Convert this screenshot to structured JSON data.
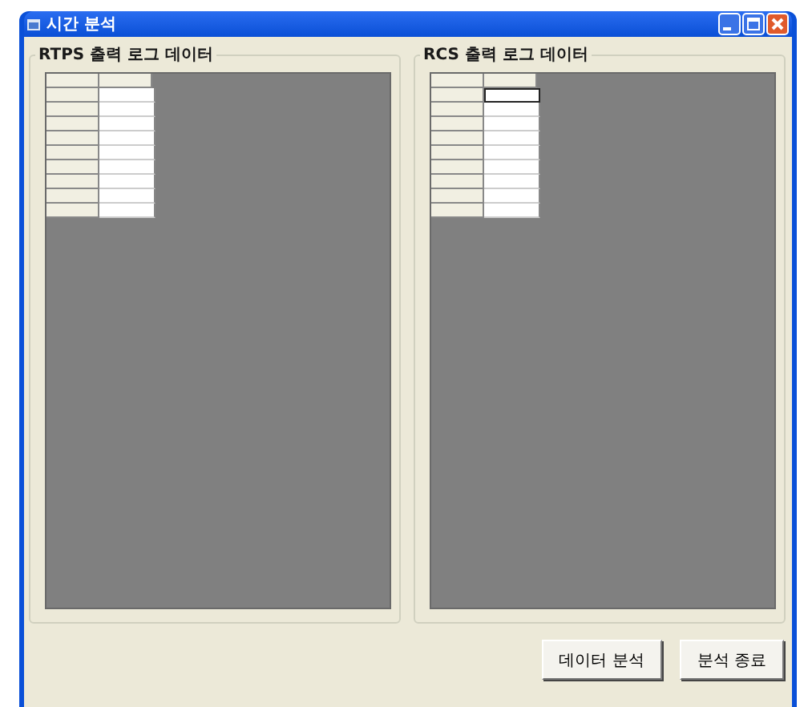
{
  "window": {
    "title": "시간 분석"
  },
  "panels": [
    {
      "title": "RTPS 출력 로그 데이터",
      "rows": [
        {
          "current": false
        },
        {
          "current": false
        },
        {
          "current": false
        },
        {
          "current": false
        },
        {
          "current": false
        },
        {
          "current": false
        },
        {
          "current": false
        },
        {
          "current": false
        },
        {
          "current": false
        }
      ]
    },
    {
      "title": "RCS 출력 로그 데이터",
      "rows": [
        {
          "current": true
        },
        {
          "current": false
        },
        {
          "current": false
        },
        {
          "current": false
        },
        {
          "current": false
        },
        {
          "current": false
        },
        {
          "current": false
        },
        {
          "current": false
        },
        {
          "current": false
        }
      ]
    }
  ],
  "buttons": [
    "데이터 분석",
    "분석 종료"
  ]
}
